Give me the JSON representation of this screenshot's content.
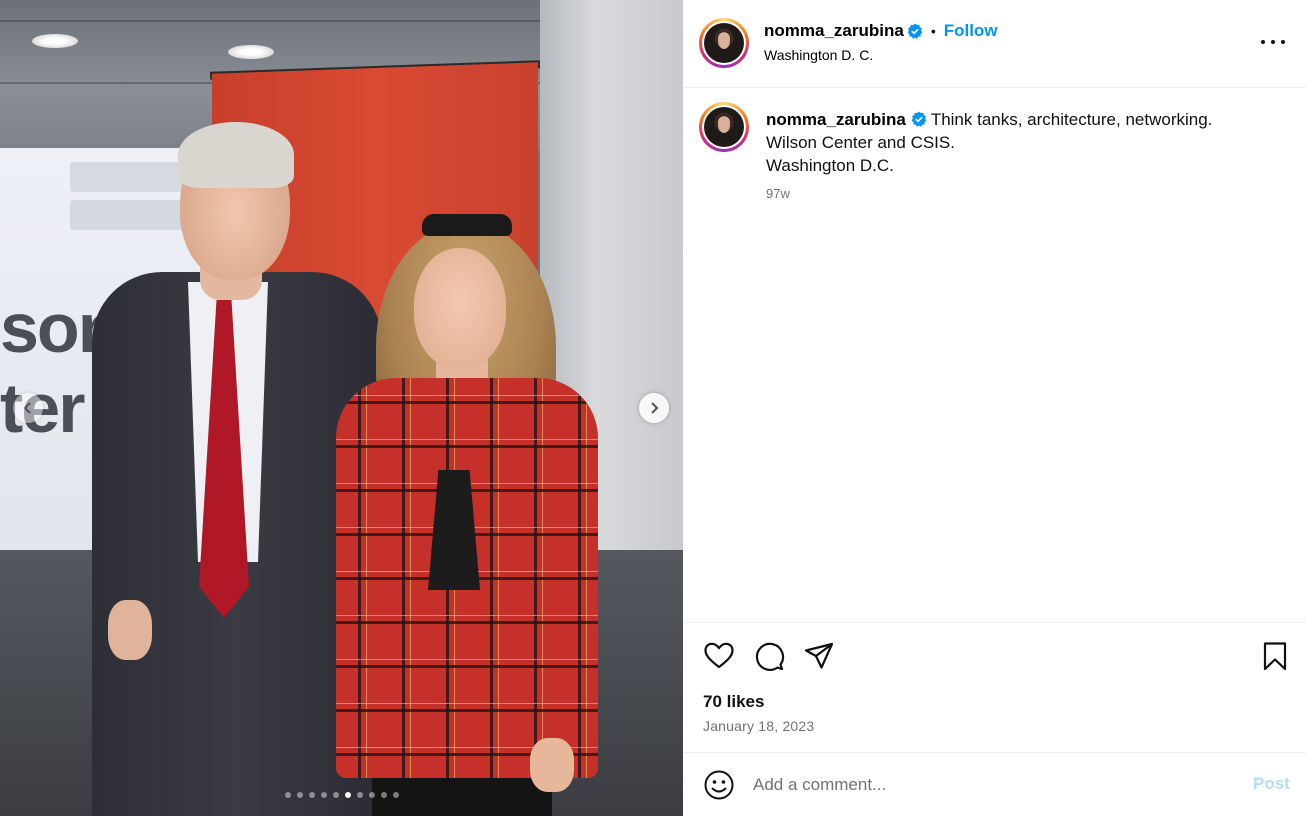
{
  "post": {
    "username": "nomma_zarubina",
    "verified": true,
    "separator": "•",
    "follow_label": "Follow",
    "location": "Washington D. C.",
    "more_label": "More options",
    "caption": {
      "username": "nomma_zarubina",
      "lines": [
        "Think tanks, architecture, networking.",
        "Wilson Center and CSIS.",
        "Washington D.C."
      ],
      "time_ago": "97w"
    },
    "likes": "70 likes",
    "date": "January 18, 2023",
    "comment_placeholder": "Add a comment...",
    "post_label": "Post"
  },
  "carousel": {
    "total_slides": 10,
    "active_index": 5
  },
  "icons": {
    "like": "heart-icon",
    "comment": "comment-icon",
    "share": "share-icon",
    "save": "bookmark-icon",
    "emoji": "emoji-icon",
    "verified": "verified-badge-icon",
    "more": "more-icon",
    "prev": "chevron-left-icon",
    "next": "chevron-right-icon"
  },
  "colors": {
    "accent": "#0095f6",
    "post_disabled": "#b3dbff",
    "muted": "#737373",
    "divider": "#efefef"
  }
}
